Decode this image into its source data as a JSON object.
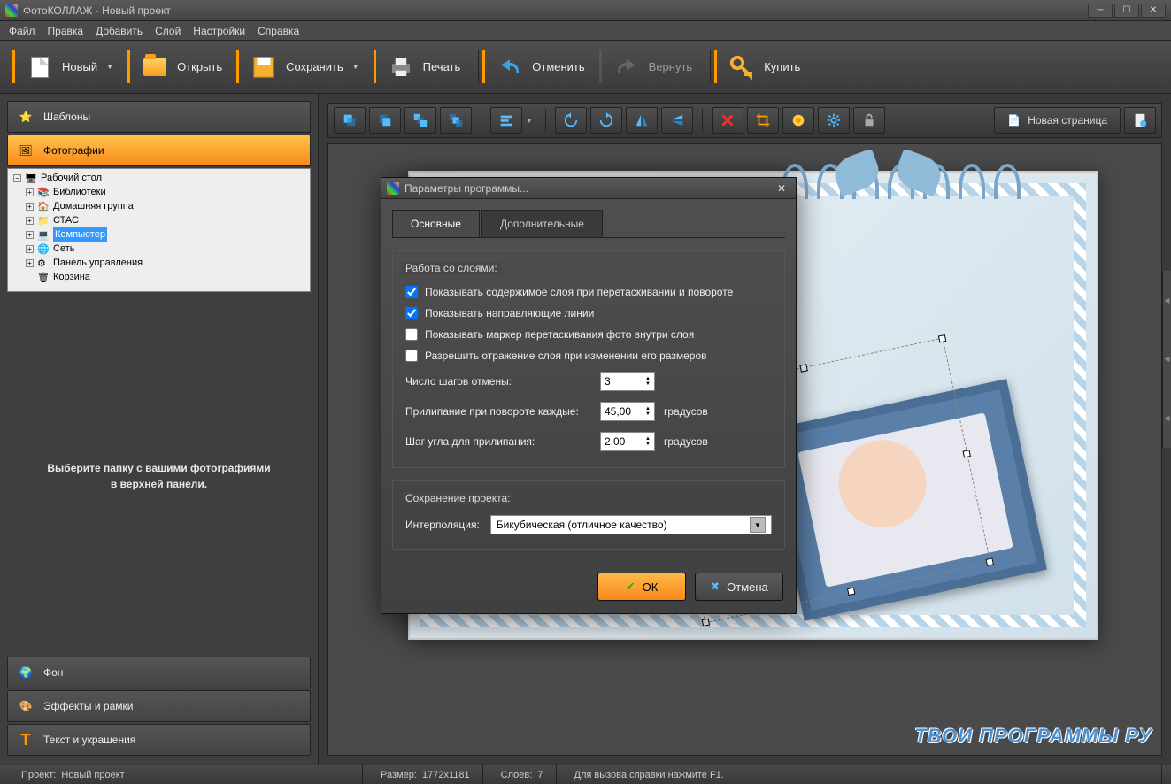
{
  "window": {
    "title": "ФотоКОЛЛАЖ - Новый проект"
  },
  "menu": {
    "items": [
      "Файл",
      "Правка",
      "Добавить",
      "Слой",
      "Настройки",
      "Справка"
    ]
  },
  "toolbar": {
    "new": "Новый",
    "open": "Открыть",
    "save": "Сохранить",
    "print": "Печать",
    "undo": "Отменить",
    "redo": "Вернуть",
    "buy": "Купить"
  },
  "sidebar": {
    "tabs": {
      "templates": "Шаблоны",
      "photos": "Фотографии",
      "background": "Фон",
      "effects": "Эффекты и рамки",
      "text": "Текст и украшения"
    },
    "tree": {
      "root": "Рабочий стол",
      "items": [
        "Библиотеки",
        "Домашняя группа",
        "СТАС",
        "Компьютер",
        "Сеть",
        "Панель управления",
        "Корзина"
      ]
    },
    "hint_line1": "Выберите папку с вашими фотографиями",
    "hint_line2": "в верхней панели."
  },
  "canvas_toolbar": {
    "new_page": "Новая страница"
  },
  "dialog": {
    "title": "Параметры программы...",
    "tabs": {
      "main": "Основные",
      "extra": "Дополнительные"
    },
    "group_layers": "Работа со слоями:",
    "check1": "Показывать содержимое слоя при перетаскивании и повороте",
    "check2": "Показывать направляющие линии",
    "check3": "Показывать маркер перетаскивания фото внутри слоя",
    "check4": "Разрешить отражение слоя при изменении его размеров",
    "undo_steps_label": "Число шагов отмены:",
    "undo_steps_value": "3",
    "snap_rotate_label": "Прилипание при повороте каждые:",
    "snap_rotate_value": "45,00",
    "snap_angle_label": "Шаг угла для прилипания:",
    "snap_angle_value": "2,00",
    "unit_degrees": "градусов",
    "group_save": "Сохранение проекта:",
    "interp_label": "Интерполяция:",
    "interp_value": "Бикубическая (отличное качество)",
    "ok": "ОК",
    "cancel": "Отмена"
  },
  "status": {
    "project_label": "Проект:",
    "project_value": "Новый проект",
    "size_label": "Размер:",
    "size_value": "1772x1181",
    "layers_label": "Слоев:",
    "layers_value": "7",
    "help": "Для вызова справки нажмите F1."
  },
  "watermark": "ТВОИ ПРОГРАММЫ РУ"
}
